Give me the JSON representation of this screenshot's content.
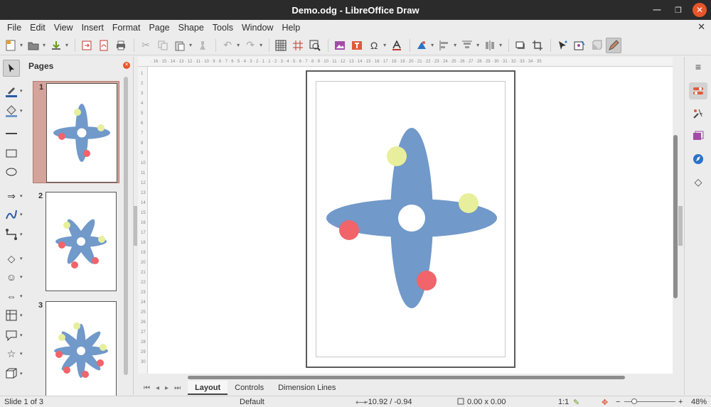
{
  "window": {
    "title": "Demo.odg - LibreOffice Draw"
  },
  "menu": [
    "File",
    "Edit",
    "View",
    "Insert",
    "Format",
    "Page",
    "Shape",
    "Tools",
    "Window",
    "Help"
  ],
  "pages_panel": {
    "title": "Pages",
    "pages": [
      "1",
      "2",
      "3"
    ]
  },
  "tabs": [
    "Layout",
    "Controls",
    "Dimension Lines"
  ],
  "ruler": {
    "h": "· 16 · 15 · 14 · 13 · 12 · 11 · 10 · 9 · 8 · 7 · 6 · 5 · 4 · 3 · 2 · 1 · 1 · 2 · 3 · 4 · 5 · 6 · 7 · 8 · 9 · 10 · 11 · 12 · 13 · 14 · 15 · 16 · 17 · 18 · 19 · 20 · 21 · 22 · 23 · 24 · 25 · 26 · 27 · 28 · 29 · 30 · 31 · 32 · 33 · 34 · 35",
    "v": [
      "1",
      "2",
      "3",
      "4",
      "5",
      "6",
      "7",
      "8",
      "9",
      "10",
      "11",
      "12",
      "13",
      "14",
      "15",
      "16",
      "17",
      "18",
      "19",
      "20",
      "21",
      "22",
      "23",
      "24",
      "25",
      "26",
      "27",
      "28",
      "29",
      "30"
    ]
  },
  "status": {
    "slide": "Slide 1 of 3",
    "master": "Default",
    "position": "-10.92 / -0.94",
    "size": "0.00 x 0.00",
    "scale": "1:1",
    "zoom": "48%"
  },
  "colors": {
    "shape_blue": "#7199ca",
    "dot_yellow": "#e8ef9c",
    "dot_red": "#f0646a",
    "selected_page": "#d4a49a"
  }
}
